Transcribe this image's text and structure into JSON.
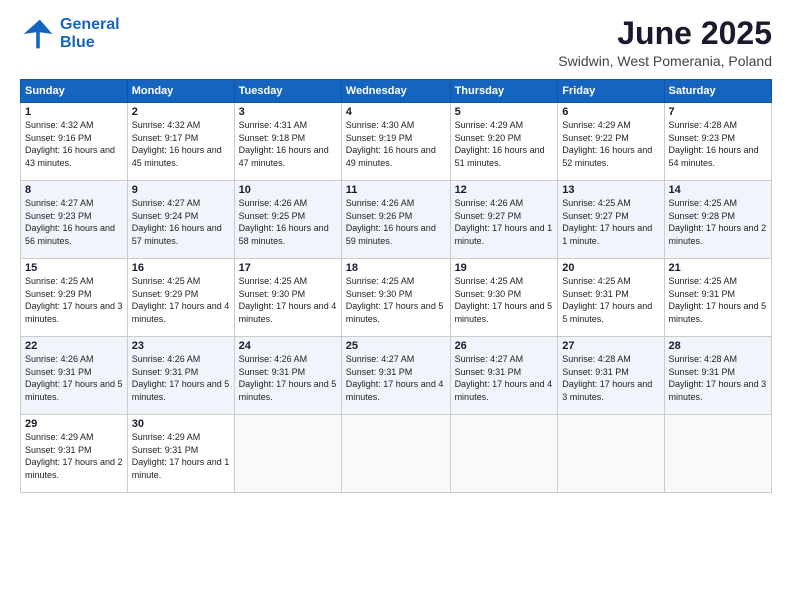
{
  "header": {
    "logo_line1": "General",
    "logo_line2": "Blue",
    "title": "June 2025",
    "subtitle": "Swidwin, West Pomerania, Poland"
  },
  "days_of_week": [
    "Sunday",
    "Monday",
    "Tuesday",
    "Wednesday",
    "Thursday",
    "Friday",
    "Saturday"
  ],
  "weeks": [
    [
      {
        "day": 1,
        "sunrise": "4:32 AM",
        "sunset": "9:16 PM",
        "daylight": "16 hours and 43 minutes."
      },
      {
        "day": 2,
        "sunrise": "4:32 AM",
        "sunset": "9:17 PM",
        "daylight": "16 hours and 45 minutes."
      },
      {
        "day": 3,
        "sunrise": "4:31 AM",
        "sunset": "9:18 PM",
        "daylight": "16 hours and 47 minutes."
      },
      {
        "day": 4,
        "sunrise": "4:30 AM",
        "sunset": "9:19 PM",
        "daylight": "16 hours and 49 minutes."
      },
      {
        "day": 5,
        "sunrise": "4:29 AM",
        "sunset": "9:20 PM",
        "daylight": "16 hours and 51 minutes."
      },
      {
        "day": 6,
        "sunrise": "4:29 AM",
        "sunset": "9:22 PM",
        "daylight": "16 hours and 52 minutes."
      },
      {
        "day": 7,
        "sunrise": "4:28 AM",
        "sunset": "9:23 PM",
        "daylight": "16 hours and 54 minutes."
      }
    ],
    [
      {
        "day": 8,
        "sunrise": "4:27 AM",
        "sunset": "9:23 PM",
        "daylight": "16 hours and 56 minutes."
      },
      {
        "day": 9,
        "sunrise": "4:27 AM",
        "sunset": "9:24 PM",
        "daylight": "16 hours and 57 minutes."
      },
      {
        "day": 10,
        "sunrise": "4:26 AM",
        "sunset": "9:25 PM",
        "daylight": "16 hours and 58 minutes."
      },
      {
        "day": 11,
        "sunrise": "4:26 AM",
        "sunset": "9:26 PM",
        "daylight": "16 hours and 59 minutes."
      },
      {
        "day": 12,
        "sunrise": "4:26 AM",
        "sunset": "9:27 PM",
        "daylight": "17 hours and 1 minute."
      },
      {
        "day": 13,
        "sunrise": "4:25 AM",
        "sunset": "9:27 PM",
        "daylight": "17 hours and 1 minute."
      },
      {
        "day": 14,
        "sunrise": "4:25 AM",
        "sunset": "9:28 PM",
        "daylight": "17 hours and 2 minutes."
      }
    ],
    [
      {
        "day": 15,
        "sunrise": "4:25 AM",
        "sunset": "9:29 PM",
        "daylight": "17 hours and 3 minutes."
      },
      {
        "day": 16,
        "sunrise": "4:25 AM",
        "sunset": "9:29 PM",
        "daylight": "17 hours and 4 minutes."
      },
      {
        "day": 17,
        "sunrise": "4:25 AM",
        "sunset": "9:30 PM",
        "daylight": "17 hours and 4 minutes."
      },
      {
        "day": 18,
        "sunrise": "4:25 AM",
        "sunset": "9:30 PM",
        "daylight": "17 hours and 5 minutes."
      },
      {
        "day": 19,
        "sunrise": "4:25 AM",
        "sunset": "9:30 PM",
        "daylight": "17 hours and 5 minutes."
      },
      {
        "day": 20,
        "sunrise": "4:25 AM",
        "sunset": "9:31 PM",
        "daylight": "17 hours and 5 minutes."
      },
      {
        "day": 21,
        "sunrise": "4:25 AM",
        "sunset": "9:31 PM",
        "daylight": "17 hours and 5 minutes."
      }
    ],
    [
      {
        "day": 22,
        "sunrise": "4:26 AM",
        "sunset": "9:31 PM",
        "daylight": "17 hours and 5 minutes."
      },
      {
        "day": 23,
        "sunrise": "4:26 AM",
        "sunset": "9:31 PM",
        "daylight": "17 hours and 5 minutes."
      },
      {
        "day": 24,
        "sunrise": "4:26 AM",
        "sunset": "9:31 PM",
        "daylight": "17 hours and 5 minutes."
      },
      {
        "day": 25,
        "sunrise": "4:27 AM",
        "sunset": "9:31 PM",
        "daylight": "17 hours and 4 minutes."
      },
      {
        "day": 26,
        "sunrise": "4:27 AM",
        "sunset": "9:31 PM",
        "daylight": "17 hours and 4 minutes."
      },
      {
        "day": 27,
        "sunrise": "4:28 AM",
        "sunset": "9:31 PM",
        "daylight": "17 hours and 3 minutes."
      },
      {
        "day": 28,
        "sunrise": "4:28 AM",
        "sunset": "9:31 PM",
        "daylight": "17 hours and 3 minutes."
      }
    ],
    [
      {
        "day": 29,
        "sunrise": "4:29 AM",
        "sunset": "9:31 PM",
        "daylight": "17 hours and 2 minutes."
      },
      {
        "day": 30,
        "sunrise": "4:29 AM",
        "sunset": "9:31 PM",
        "daylight": "17 hours and 1 minute."
      },
      null,
      null,
      null,
      null,
      null
    ]
  ]
}
